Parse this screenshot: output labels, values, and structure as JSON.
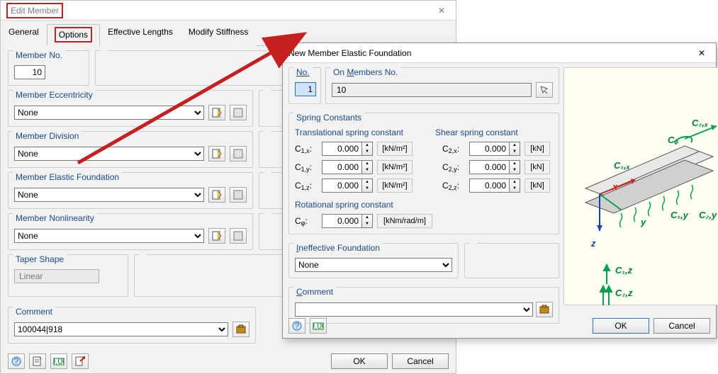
{
  "parent": {
    "title": "Edit Member",
    "tabs": [
      "General",
      "Options",
      "Effective Lengths",
      "Modify Stiffness"
    ],
    "active_tab": 1,
    "groups": {
      "member_no": {
        "title": "Member No.",
        "value": "10"
      },
      "eccentricity": {
        "title": "Member Eccentricity",
        "value": "None"
      },
      "division": {
        "title": "Member Division",
        "value": "None"
      },
      "elastic_foundation": {
        "title": "Member Elastic Foundation",
        "value": "None"
      },
      "nonlinearity": {
        "title": "Member Nonlinearity",
        "value": "None"
      },
      "taper": {
        "title": "Taper Shape",
        "value": "Linear"
      },
      "comment": {
        "title": "Comment",
        "value": "100044|918"
      }
    },
    "buttons": {
      "ok": "OK",
      "cancel": "Cancel"
    }
  },
  "child": {
    "title": "New Member Elastic Foundation",
    "no_label": "No.",
    "no_value": "1",
    "on_members_label": "On Members No.",
    "on_members_value": "10",
    "spring_constants_title": "Spring Constants",
    "translational_header": "Translational spring constant",
    "shear_header": "Shear spring constant",
    "rotational_header": "Rotational spring constant",
    "fields": {
      "c1x": {
        "label_pre": "C",
        "label_sub": "1,x",
        "value": "0.000",
        "unit": "[kN/m²]"
      },
      "c1y": {
        "label_pre": "C",
        "label_sub": "1,y",
        "value": "0.000",
        "unit": "[kN/m²]"
      },
      "c1z": {
        "label_pre": "C",
        "label_sub": "1,z",
        "value": "0.000",
        "unit": "[kN/m²]"
      },
      "c2x": {
        "label_pre": "C",
        "label_sub": "2,x",
        "value": "0.000",
        "unit": "[kN]"
      },
      "c2y": {
        "label_pre": "C",
        "label_sub": "2,y",
        "value": "0.000",
        "unit": "[kN]"
      },
      "c2z": {
        "label_pre": "C",
        "label_sub": "2,z",
        "value": "0.000",
        "unit": "[kN]"
      },
      "cphi": {
        "label_pre": "C",
        "label_sub": "φ",
        "value": "0.000",
        "unit": "[kNm/rad/m]"
      }
    },
    "ineffective_title": "Ineffective Foundation",
    "ineffective_value": "None",
    "comment_title": "Comment",
    "comment_value": "",
    "buttons": {
      "ok": "OK",
      "cancel": "Cancel"
    },
    "diagram": {
      "labels": [
        "C₂,ₓ",
        "Cᵩ",
        "C₁,ₓ",
        "x",
        "C₁,y",
        "C₂,y",
        "y",
        "z",
        "C₁,z",
        "C₂,z"
      ]
    }
  }
}
